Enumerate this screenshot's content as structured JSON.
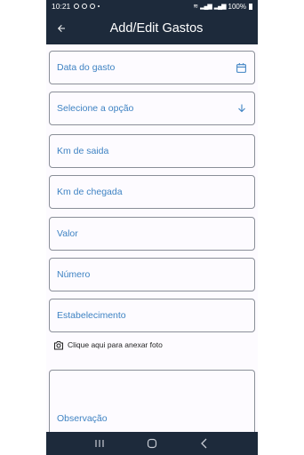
{
  "status_bar": {
    "time": "10:21",
    "battery": "100%"
  },
  "app_bar": {
    "title": "Add/Edit Gastos",
    "back_icon": "arrow-back-icon"
  },
  "form": {
    "date_label": "Data do gasto",
    "option_label": "Selecione a opção",
    "km_saida_label": "Km de saida",
    "km_chegada_label": "Km de chegada",
    "valor_label": "Valor",
    "numero_label": "Número",
    "estabelecimento_label": "Estabelecimento",
    "attach_label": "Clique aqui para anexar foto",
    "observacao_label": "Observação"
  },
  "colors": {
    "app_bar": "#1d2a3b",
    "label": "#3f83c3",
    "border": "#8a8f98",
    "background": "#fdfbff"
  },
  "icons": {
    "calendar": "calendar-icon",
    "dropdown": "arrow-down-icon",
    "camera": "camera-icon",
    "nav_recent": "recent-apps-icon",
    "nav_home": "home-icon",
    "nav_back": "back-icon"
  }
}
